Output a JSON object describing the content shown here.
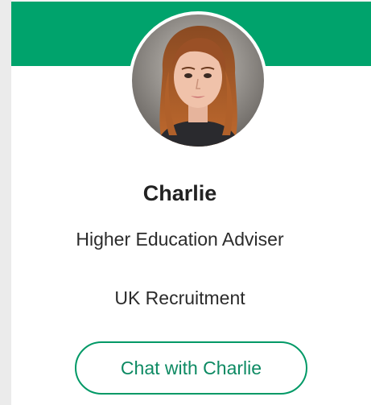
{
  "profile": {
    "name": "Charlie",
    "role": "Higher Education Adviser",
    "department": "UK Recruitment",
    "chat_button_label": "Chat with Charlie",
    "avatar_icon": "profile-photo"
  },
  "colors": {
    "accent": "#00a36c",
    "button_border": "#009966",
    "button_text": "#0d8a63",
    "page_background": "#ebebeb",
    "card_background": "#ffffff"
  }
}
